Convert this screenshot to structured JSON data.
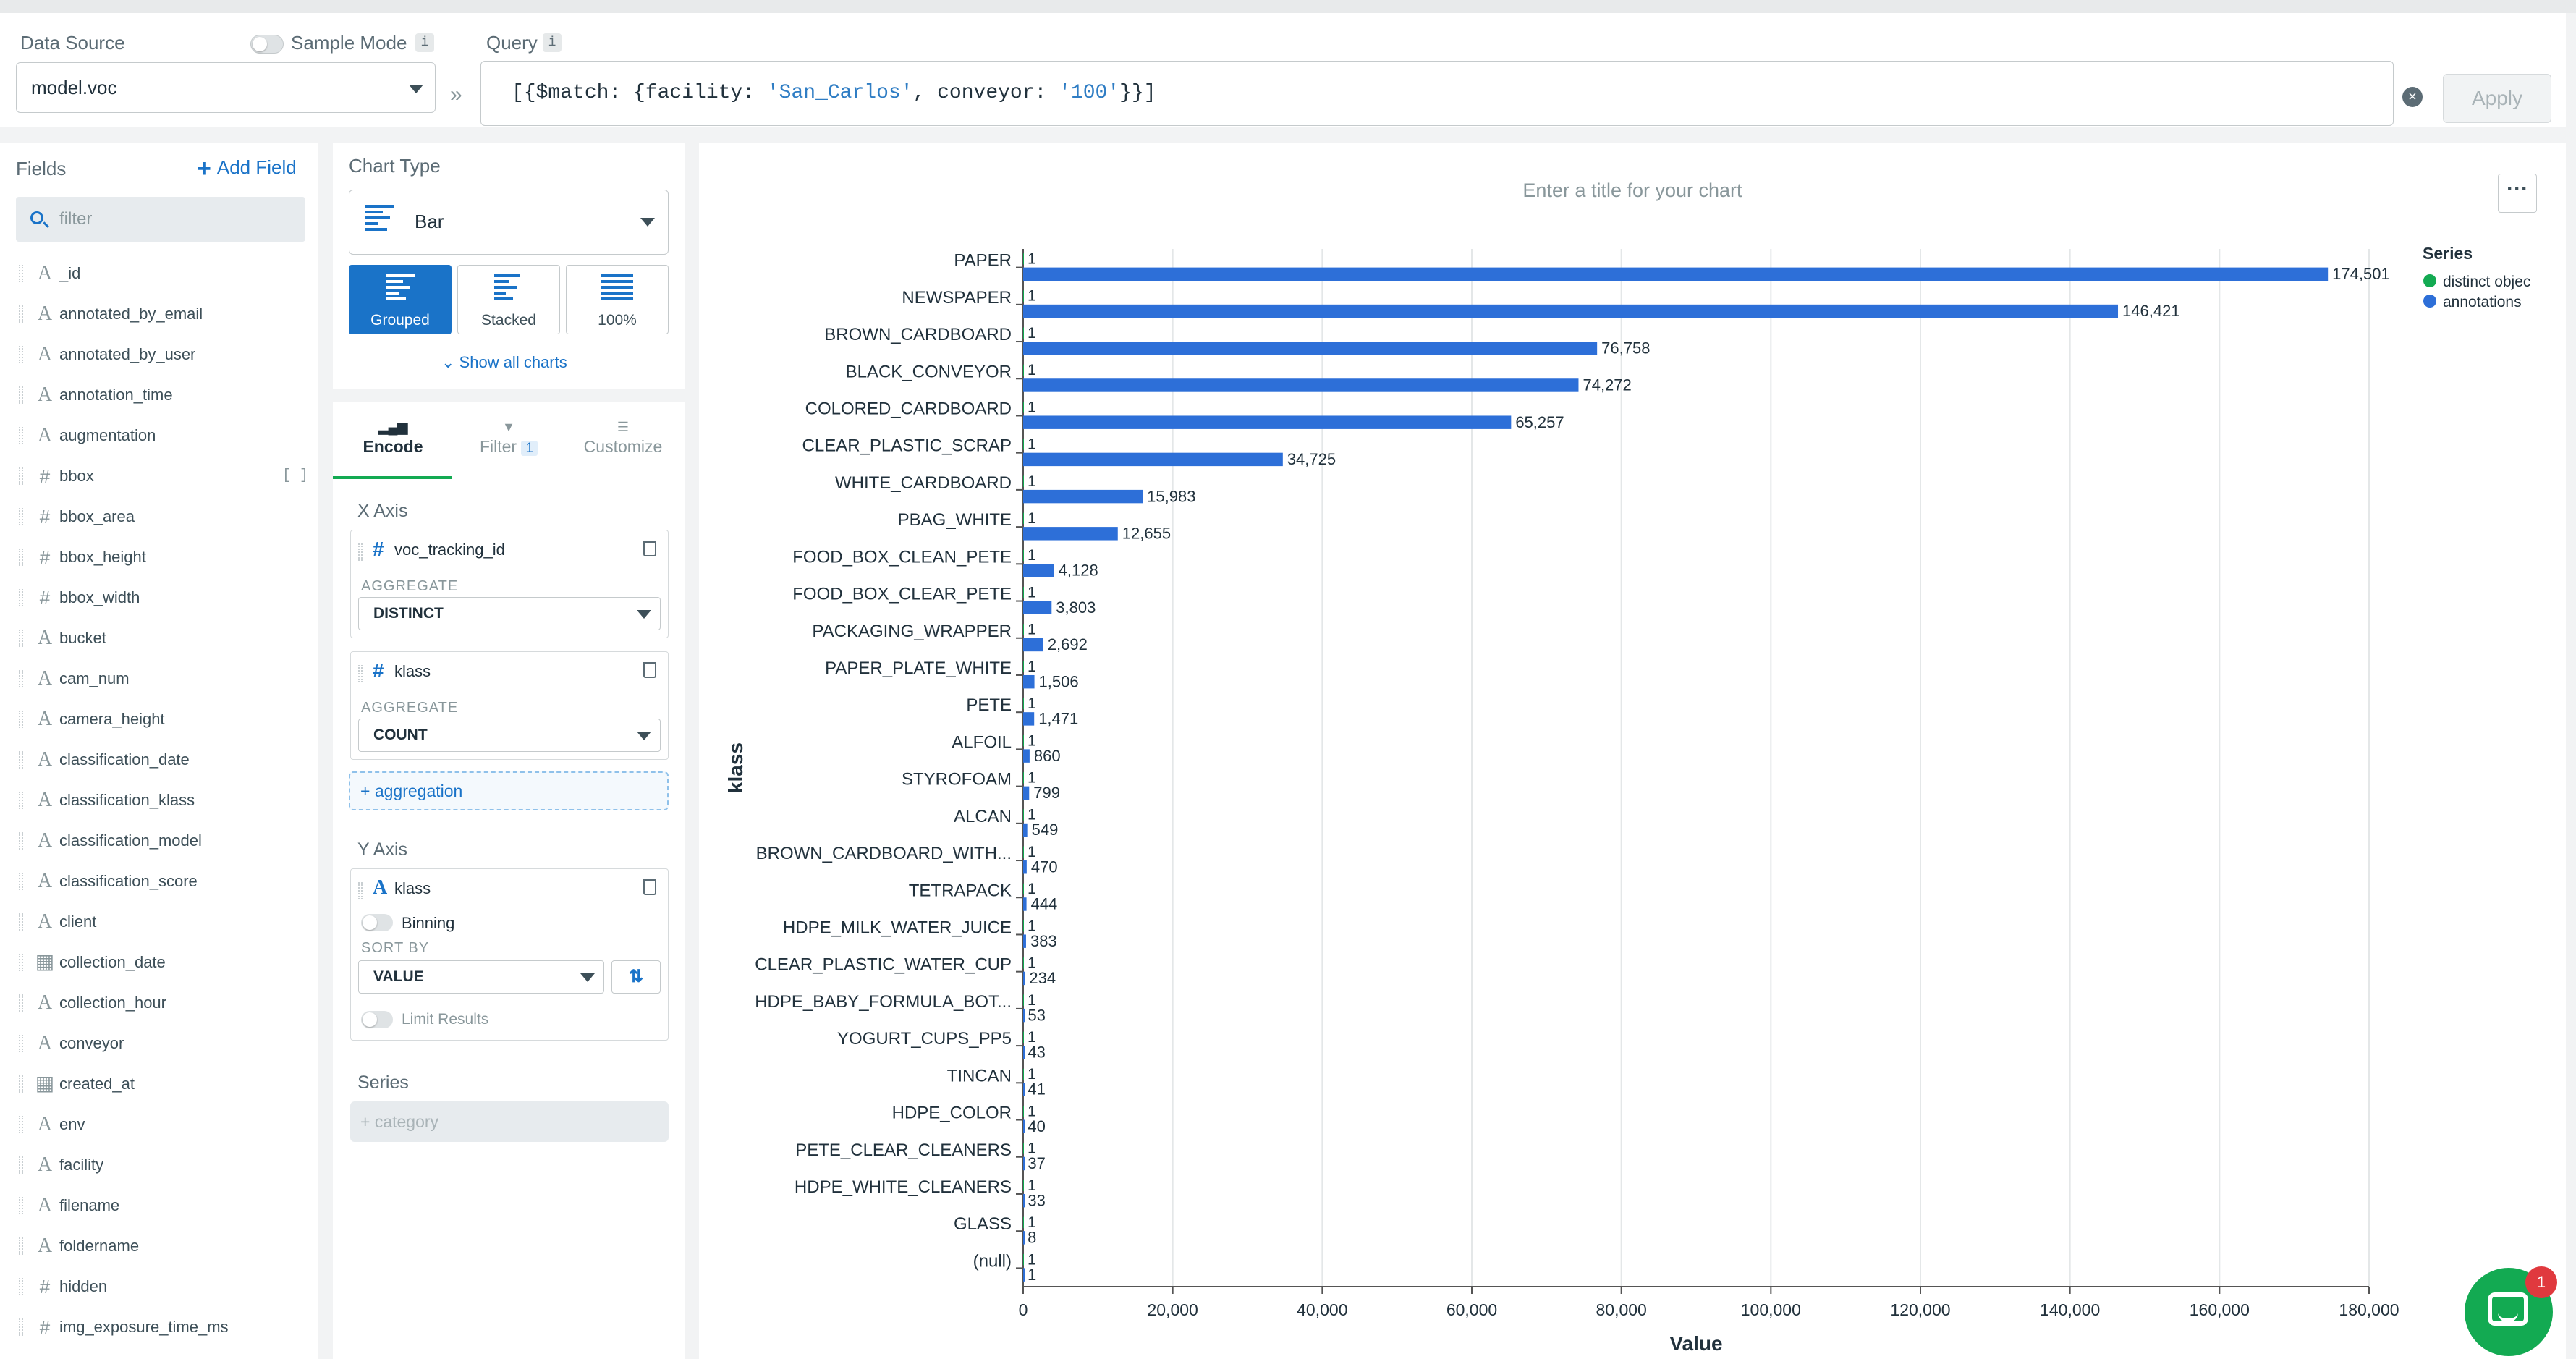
{
  "data_source": {
    "label": "Data Source",
    "value": "model.voc",
    "sample_mode_label": "Sample Mode",
    "info": "i"
  },
  "query": {
    "label": "Query",
    "info": "i",
    "prefix": "[{$match: {facility: ",
    "facility": "'San_Carlos'",
    "middle": ", conveyor: ",
    "conveyor": "'100'",
    "suffix": "}}]",
    "apply_label": "Apply",
    "separator": "»"
  },
  "fields": {
    "title": "Fields",
    "add_label": "Add Field",
    "filter_placeholder": "filter",
    "items": [
      {
        "name": "_id",
        "type": "A"
      },
      {
        "name": "annotated_by_email",
        "type": "A"
      },
      {
        "name": "annotated_by_user",
        "type": "A"
      },
      {
        "name": "annotation_time",
        "type": "A"
      },
      {
        "name": "augmentation",
        "type": "A"
      },
      {
        "name": "bbox",
        "type": "#",
        "expand": "[ ]"
      },
      {
        "name": "bbox_area",
        "type": "#"
      },
      {
        "name": "bbox_height",
        "type": "#"
      },
      {
        "name": "bbox_width",
        "type": "#"
      },
      {
        "name": "bucket",
        "type": "A"
      },
      {
        "name": "cam_num",
        "type": "A"
      },
      {
        "name": "camera_height",
        "type": "A"
      },
      {
        "name": "classification_date",
        "type": "A"
      },
      {
        "name": "classification_klass",
        "type": "A"
      },
      {
        "name": "classification_model",
        "type": "A"
      },
      {
        "name": "classification_score",
        "type": "A"
      },
      {
        "name": "client",
        "type": "A"
      },
      {
        "name": "collection_date",
        "type": "date"
      },
      {
        "name": "collection_hour",
        "type": "A"
      },
      {
        "name": "conveyor",
        "type": "A"
      },
      {
        "name": "created_at",
        "type": "date"
      },
      {
        "name": "env",
        "type": "A"
      },
      {
        "name": "facility",
        "type": "A"
      },
      {
        "name": "filename",
        "type": "A"
      },
      {
        "name": "foldername",
        "type": "A"
      },
      {
        "name": "hidden",
        "type": "#"
      },
      {
        "name": "img_exposure_time_ms",
        "type": "#"
      }
    ]
  },
  "chart_type": {
    "title": "Chart Type",
    "selected": "Bar",
    "subtypes": [
      "Grouped",
      "Stacked",
      "100%"
    ],
    "active_subtype": "Grouped",
    "show_all": "Show all charts"
  },
  "encode": {
    "tabs": [
      "Encode",
      "Filter",
      "Customize"
    ],
    "filter_count": "1",
    "x_axis_title": "X Axis",
    "x_fields": [
      {
        "name": "voc_tracking_id",
        "type": "#",
        "aggregate_label": "AGGREGATE",
        "aggregate": "DISTINCT"
      },
      {
        "name": "klass",
        "type": "#",
        "aggregate_label": "AGGREGATE",
        "aggregate": "COUNT"
      }
    ],
    "add_aggregation": "+ aggregation",
    "y_axis_title": "Y Axis",
    "y_field": {
      "name": "klass",
      "type": "A",
      "binning": "Binning",
      "sort_label": "SORT BY",
      "sort": "VALUE",
      "limit": "Limit Results"
    },
    "series_title": "Series",
    "series_placeholder": "+ category"
  },
  "chart": {
    "title_placeholder": "Enter a title for your chart",
    "more": "···",
    "chat_badge": "1"
  },
  "chart_data": {
    "type": "bar",
    "orientation": "horizontal",
    "title": "",
    "xlabel": "Value",
    "ylabel": "klass",
    "xlim": [
      0,
      180000
    ],
    "x_ticks": [
      "0",
      "20,000",
      "40,000",
      "60,000",
      "80,000",
      "100,000",
      "120,000",
      "140,000",
      "160,000",
      "180,000"
    ],
    "grid": "vertical",
    "legend_title": "Series",
    "legend_position": "top-right",
    "categories": [
      "PAPER",
      "NEWSPAPER",
      "BROWN_CARDBOARD",
      "BLACK_CONVEYOR",
      "COLORED_CARDBOARD",
      "CLEAR_PLASTIC_SCRAP",
      "WHITE_CARDBOARD",
      "PBAG_WHITE",
      "FOOD_BOX_CLEAN_PETE",
      "FOOD_BOX_CLEAR_PETE",
      "PACKAGING_WRAPPER",
      "PAPER_PLATE_WHITE",
      "PETE",
      "ALFOIL",
      "STYROFOAM",
      "ALCAN",
      "BROWN_CARDBOARD_WITH...",
      "TETRAPACK",
      "HDPE_MILK_WATER_JUICE",
      "CLEAR_PLASTIC_WATER_CUP",
      "HDPE_BABY_FORMULA_BOT...",
      "YOGURT_CUPS_PP5",
      "TINCAN",
      "HDPE_COLOR",
      "PETE_CLEAR_CLEANERS",
      "HDPE_WHITE_CLEANERS",
      "GLASS",
      "(null)"
    ],
    "series": [
      {
        "name": "distinct objec",
        "color": "#13aa52",
        "values": [
          1,
          1,
          1,
          1,
          1,
          1,
          1,
          1,
          1,
          1,
          1,
          1,
          1,
          1,
          1,
          1,
          1,
          1,
          1,
          1,
          1,
          1,
          1,
          1,
          1,
          1,
          1,
          1
        ]
      },
      {
        "name": "annotations",
        "color": "#2d6fd8",
        "values": [
          174501,
          146421,
          76758,
          74272,
          65257,
          34725,
          15983,
          12655,
          4128,
          3803,
          2692,
          1506,
          1471,
          860,
          799,
          549,
          470,
          444,
          383,
          234,
          53,
          43,
          41,
          40,
          37,
          33,
          8,
          1
        ]
      }
    ]
  }
}
